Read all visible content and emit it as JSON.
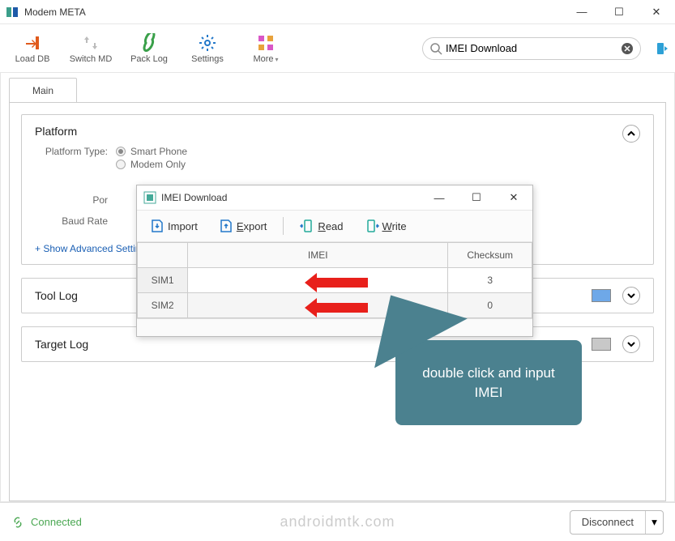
{
  "window": {
    "title": "Modem META"
  },
  "toolbar": {
    "load_db": "Load DB",
    "switch_md": "Switch MD",
    "pack_log": "Pack Log",
    "settings": "Settings",
    "more": "More"
  },
  "search": {
    "value": "IMEI Download",
    "placeholder": "Search"
  },
  "tabs": {
    "main": "Main"
  },
  "platform": {
    "title": "Platform",
    "type_label": "Platform Type:",
    "smart_phone": "Smart Phone",
    "modem_only": "Modem Only",
    "port_label": "Por",
    "baud_label": "Baud Rate",
    "advanced_link": "+ Show Advanced Setting"
  },
  "tool_log": {
    "title": "Tool Log"
  },
  "target_log": {
    "title": "Target Log"
  },
  "dialog": {
    "title": "IMEI Download",
    "import": "Import",
    "export_prefix": "E",
    "export_rest": "xport",
    "read_prefix": "R",
    "read_rest": "ead",
    "write_prefix": "W",
    "write_rest": "rite",
    "col_imei": "IMEI",
    "col_checksum": "Checksum",
    "rows": [
      {
        "sim": "SIM1",
        "imei": "",
        "checksum": "3"
      },
      {
        "sim": "SIM2",
        "imei": "",
        "checksum": "0"
      }
    ]
  },
  "callout": {
    "text": "double click and input IMEI"
  },
  "status": {
    "connected": "Connected",
    "watermark": "androidmtk.com",
    "disconnect": "Disconnect"
  }
}
